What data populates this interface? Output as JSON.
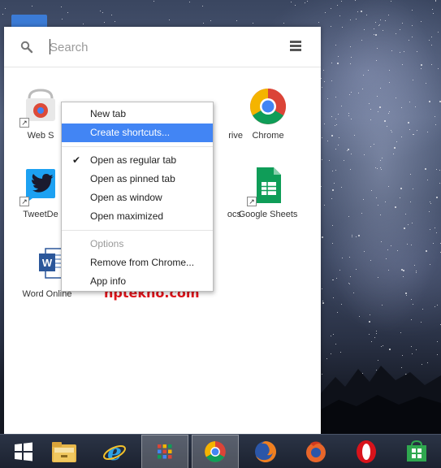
{
  "search": {
    "placeholder": "Search"
  },
  "apps": [
    {
      "label": "Web S",
      "icon": "web-store-icon"
    },
    {
      "label": "rive",
      "icon": "drive-icon"
    },
    {
      "label": "Chrome",
      "icon": "chrome-icon"
    },
    {
      "label": "TweetDe",
      "icon": "tweetdeck-icon"
    },
    {
      "label": "ocs",
      "icon": "docs-icon"
    },
    {
      "label": "Google Sheets",
      "icon": "sheets-icon"
    },
    {
      "label": "Word Online",
      "icon": "word-online-icon"
    }
  ],
  "context_menu": {
    "items": [
      {
        "label": "New tab"
      },
      {
        "label": "Create shortcuts...",
        "highlighted": true
      },
      {
        "label": "Open as regular tab",
        "checked": true
      },
      {
        "label": "Open as pinned tab"
      },
      {
        "label": "Open as window"
      },
      {
        "label": "Open maximized"
      },
      {
        "label": "Options",
        "disabled": true
      },
      {
        "label": "Remove from Chrome..."
      },
      {
        "label": "App info"
      }
    ],
    "highlight_color": "#4285f4"
  },
  "watermark": "hptekno.com",
  "taskbar": {
    "items": [
      {
        "icon": "windows-start-icon"
      },
      {
        "icon": "file-explorer-icon"
      },
      {
        "icon": "internet-explorer-icon"
      },
      {
        "icon": "app-launcher-icon",
        "active": true
      },
      {
        "icon": "chrome-icon",
        "active": true
      },
      {
        "icon": "firefox-icon"
      },
      {
        "icon": "firefox-developer-icon"
      },
      {
        "icon": "opera-icon"
      },
      {
        "icon": "windows-store-icon"
      }
    ]
  }
}
